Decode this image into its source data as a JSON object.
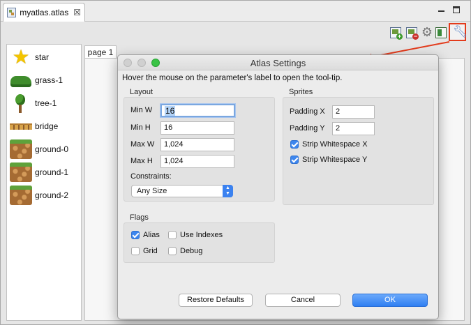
{
  "editor": {
    "tab_title": "myatlas.atlas",
    "close_glyph": "☒",
    "toolbar_icons": [
      "add-image-icon",
      "remove-image-icon",
      "gear-icon",
      "export-icon",
      "wrench-icon"
    ]
  },
  "sprites": [
    {
      "label": "star",
      "icon": "star-icon"
    },
    {
      "label": "grass-1",
      "icon": "grass-icon"
    },
    {
      "label": "tree-1",
      "icon": "tree-icon"
    },
    {
      "label": "bridge",
      "icon": "bridge-icon"
    },
    {
      "label": "ground-0",
      "icon": "ground-icon"
    },
    {
      "label": "ground-1",
      "icon": "ground-icon"
    },
    {
      "label": "ground-2",
      "icon": "ground-icon"
    }
  ],
  "page": {
    "tab_label": "page 1"
  },
  "dialog": {
    "title": "Atlas Settings",
    "hint": "Hover the mouse on the parameter's label to open the tool-tip.",
    "layout": {
      "title": "Layout",
      "min_w_label": "Min W",
      "min_w_value": "16",
      "min_h_label": "Min H",
      "min_h_value": "16",
      "max_w_label": "Max W",
      "max_w_value": "1,024",
      "max_h_label": "Max H",
      "max_h_value": "1,024",
      "constraints_label": "Constraints:",
      "constraints_value": "Any Size"
    },
    "sprites": {
      "title": "Sprites",
      "padding_x_label": "Padding X",
      "padding_x_value": "2",
      "padding_y_label": "Padding Y",
      "padding_y_value": "2",
      "strip_x_label": "Strip Whitespace X",
      "strip_x_checked": true,
      "strip_y_label": "Strip Whitespace Y",
      "strip_y_checked": true
    },
    "flags": {
      "title": "Flags",
      "alias_label": "Alias",
      "alias_checked": true,
      "use_indexes_label": "Use Indexes",
      "use_indexes_checked": false,
      "grid_label": "Grid",
      "grid_checked": false,
      "debug_label": "Debug",
      "debug_checked": false
    },
    "buttons": {
      "restore": "Restore Defaults",
      "cancel": "Cancel",
      "ok": "OK"
    }
  },
  "colors": {
    "accent": "#3d86ee",
    "highlight": "#e33b1c"
  }
}
